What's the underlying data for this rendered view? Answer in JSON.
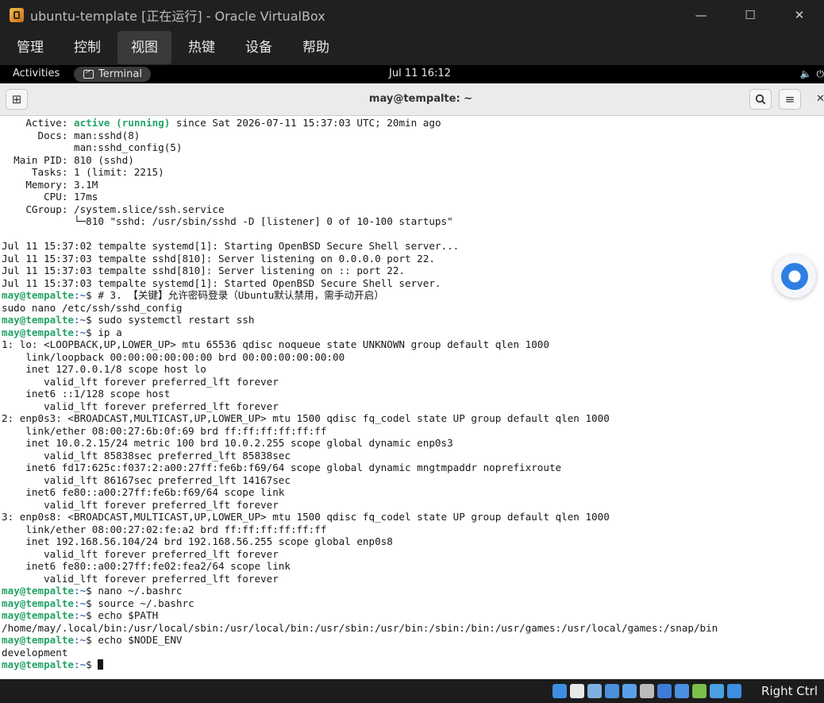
{
  "vbox": {
    "title": "ubuntu-template [正在运行] - Oracle VirtualBox",
    "menus": [
      "管理",
      "控制",
      "视图",
      "热键",
      "设备",
      "帮助"
    ],
    "active_menu_index": 2,
    "host_key": "Right Ctrl"
  },
  "gnome": {
    "activities": "Activities",
    "app_label": "Terminal",
    "clock": "Jul 11  16:12"
  },
  "terminal": {
    "title": "may@tempalte: ~",
    "prompt_user": "may@tempalte",
    "prompt_path": ":~",
    "lines": [
      {
        "t": "    Active: ",
        "hl": "active (running)",
        "r": " since Sat 2026-07-11 15:37:03 UTC; 20min ago"
      },
      {
        "t": "      Docs: man:sshd(8)"
      },
      {
        "t": "            man:sshd_config(5)"
      },
      {
        "t": "  Main PID: 810 (sshd)"
      },
      {
        "t": "     Tasks: 1 (limit: 2215)"
      },
      {
        "t": "    Memory: 3.1M"
      },
      {
        "t": "       CPU: 17ms"
      },
      {
        "t": "    CGroup: /system.slice/ssh.service"
      },
      {
        "t": "            └─810 \"sshd: /usr/sbin/sshd -D [listener] 0 of 10-100 startups\""
      },
      {
        "t": ""
      },
      {
        "t": "Jul 11 15:37:02 tempalte systemd[1]: Starting OpenBSD Secure Shell server..."
      },
      {
        "t": "Jul 11 15:37:03 tempalte sshd[810]: Server listening on 0.0.0.0 port 22."
      },
      {
        "t": "Jul 11 15:37:03 tempalte sshd[810]: Server listening on :: port 22."
      },
      {
        "t": "Jul 11 15:37:03 tempalte systemd[1]: Started OpenBSD Secure Shell server."
      },
      {
        "p": true,
        "t": "$ # 3. 【关键】允许密码登录（Ubuntu默认禁用，需手动开启）"
      },
      {
        "t": "sudo nano /etc/ssh/sshd_config"
      },
      {
        "p": true,
        "t": "$ sudo systemctl restart ssh"
      },
      {
        "p": true,
        "t": "$ ip a"
      },
      {
        "t": "1: lo: <LOOPBACK,UP,LOWER_UP> mtu 65536 qdisc noqueue state UNKNOWN group default qlen 1000"
      },
      {
        "t": "    link/loopback 00:00:00:00:00:00 brd 00:00:00:00:00:00"
      },
      {
        "t": "    inet 127.0.0.1/8 scope host lo"
      },
      {
        "t": "       valid_lft forever preferred_lft forever"
      },
      {
        "t": "    inet6 ::1/128 scope host"
      },
      {
        "t": "       valid_lft forever preferred_lft forever"
      },
      {
        "t": "2: enp0s3: <BROADCAST,MULTICAST,UP,LOWER_UP> mtu 1500 qdisc fq_codel state UP group default qlen 1000"
      },
      {
        "t": "    link/ether 08:00:27:6b:0f:69 brd ff:ff:ff:ff:ff:ff"
      },
      {
        "t": "    inet 10.0.2.15/24 metric 100 brd 10.0.2.255 scope global dynamic enp0s3"
      },
      {
        "t": "       valid_lft 85838sec preferred_lft 85838sec"
      },
      {
        "t": "    inet6 fd17:625c:f037:2:a00:27ff:fe6b:f69/64 scope global dynamic mngtmpaddr noprefixroute"
      },
      {
        "t": "       valid_lft 86167sec preferred_lft 14167sec"
      },
      {
        "t": "    inet6 fe80::a00:27ff:fe6b:f69/64 scope link"
      },
      {
        "t": "       valid_lft forever preferred_lft forever"
      },
      {
        "t": "3: enp0s8: <BROADCAST,MULTICAST,UP,LOWER_UP> mtu 1500 qdisc fq_codel state UP group default qlen 1000"
      },
      {
        "t": "    link/ether 08:00:27:02:fe:a2 brd ff:ff:ff:ff:ff:ff"
      },
      {
        "t": "    inet 192.168.56.104/24 brd 192.168.56.255 scope global enp0s8"
      },
      {
        "t": "       valid_lft forever preferred_lft forever"
      },
      {
        "t": "    inet6 fe80::a00:27ff:fe02:fea2/64 scope link"
      },
      {
        "t": "       valid_lft forever preferred_lft forever"
      },
      {
        "p": true,
        "t": "$ nano ~/.bashrc"
      },
      {
        "p": true,
        "t": "$ source ~/.bashrc"
      },
      {
        "p": true,
        "t": "$ echo $PATH"
      },
      {
        "t": "/home/may/.local/bin:/usr/local/sbin:/usr/local/bin:/usr/sbin:/usr/bin:/sbin:/bin:/usr/games:/usr/local/games:/snap/bin"
      },
      {
        "p": true,
        "t": "$ echo $NODE_ENV"
      },
      {
        "t": "development"
      },
      {
        "p": true,
        "t": "$ ",
        "cursor": true
      }
    ]
  },
  "status_icon_colors": [
    "#3d8ee0",
    "#e8e8e8",
    "#7fb0e0",
    "#4a90d9",
    "#5aa0e8",
    "#bbbbbb",
    "#3d7dd8",
    "#4a8fe0",
    "#7bbf4a",
    "#4aa0e0",
    "#3d8ee0"
  ]
}
